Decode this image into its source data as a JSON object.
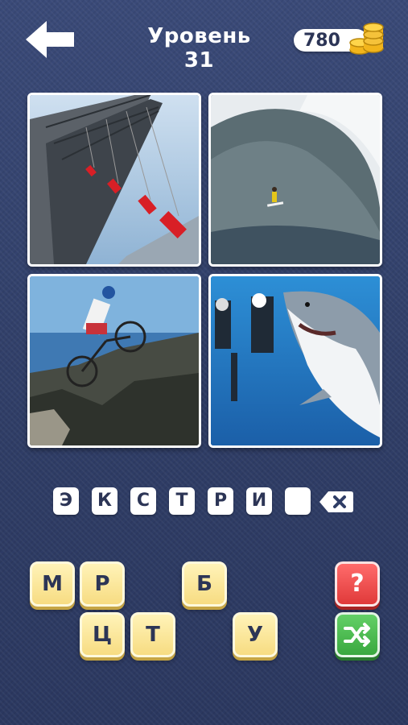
{
  "header": {
    "back_icon": "back-arrow-icon",
    "level_title": "Уровень 31",
    "coins": "780",
    "coins_icon": "gold-coins-icon"
  },
  "photos": [
    {
      "name": "people-bungee-on-bridge"
    },
    {
      "name": "surfer-on-giant-wave"
    },
    {
      "name": "cyclist-jumping-over-cliff"
    },
    {
      "name": "divers-with-shark"
    }
  ],
  "answer": {
    "letters": [
      "Э",
      "К",
      "С",
      "Т",
      "Р",
      "И",
      ""
    ],
    "erase_icon": "backspace-icon"
  },
  "tiles": [
    "М",
    "Р",
    "Б",
    "Ц",
    "Т",
    "У"
  ],
  "actions": {
    "hint_label": "?",
    "hint_icon": "hint-icon",
    "shuffle_icon": "shuffle-icon"
  },
  "colors": {
    "background": "#334270",
    "tile": "#f7dc82",
    "hint": "#e03a3a",
    "shuffle": "#3aa83f"
  }
}
